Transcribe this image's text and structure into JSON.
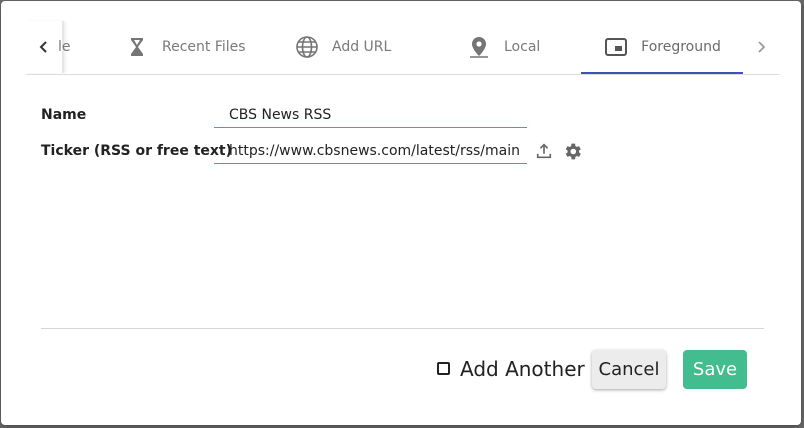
{
  "tabs": {
    "partial_label": "le",
    "items": [
      {
        "label": "Recent Files",
        "icon": "hourglass-icon"
      },
      {
        "label": "Add URL",
        "icon": "globe-icon"
      },
      {
        "label": "Local",
        "icon": "map-pin-icon"
      },
      {
        "label": "Foreground",
        "icon": "picture-in-picture-icon",
        "active": true
      }
    ]
  },
  "form": {
    "name_label": "Name",
    "name_value": "CBS News RSS",
    "ticker_label": "Ticker (RSS or free text)",
    "ticker_value": "https://www.cbsnews.com/latest/rss/main"
  },
  "footer": {
    "add_another_label": "Add Another",
    "cancel_label": "Cancel",
    "save_label": "Save"
  },
  "colors": {
    "accent_tab": "#3f51b5",
    "field_underline": "#2bb39b",
    "save_button": "#43bd8f"
  }
}
